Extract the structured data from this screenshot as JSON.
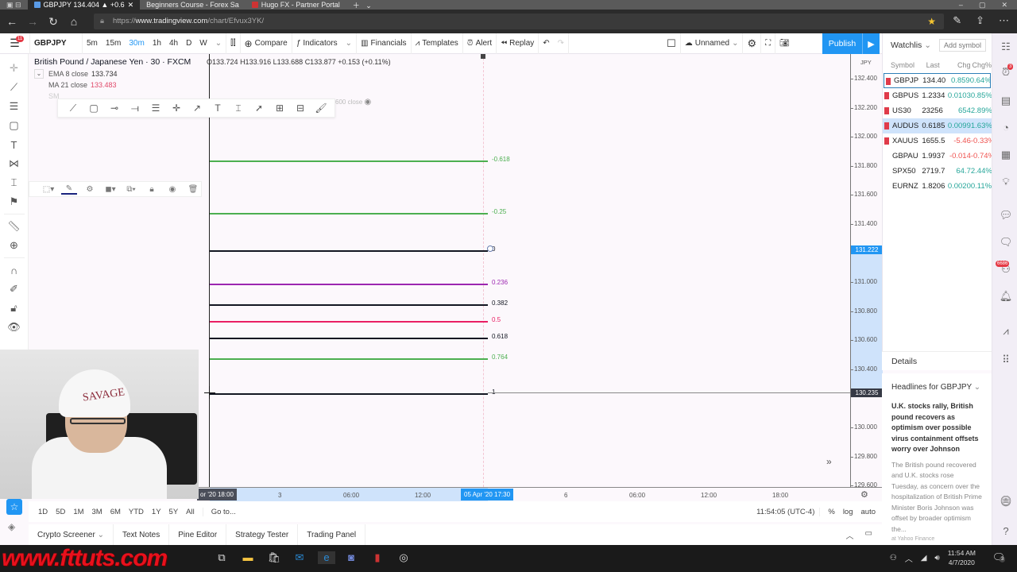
{
  "browser": {
    "tabs": [
      {
        "label": "GBPJPY 134.404 ▲ +0.6",
        "active": true
      },
      {
        "label": "Beginners Course - Forex Sa",
        "active": false
      },
      {
        "label": "Hugo FX - Partner Portal",
        "active": false
      }
    ],
    "url_prefix": "https://",
    "url_domain": "www.tradingview.com",
    "url_path": "/chart/Efvux3YK/"
  },
  "toolbar": {
    "menu_badge": "11",
    "symbol": "GBPJPY",
    "intervals": [
      "5m",
      "15m",
      "30m",
      "1h",
      "4h",
      "D",
      "W"
    ],
    "active_interval": "30m",
    "compare": "Compare",
    "indicators": "Indicators",
    "financials": "Financials",
    "templates": "Templates",
    "alert": "Alert",
    "replay": "Replay",
    "layout_name": "Unnamed",
    "publish": "Publish"
  },
  "legend": {
    "title": "British Pound / Japanese Yen · 30 · FXCM",
    "open": "O133.724",
    "high": "H133.916",
    "low": "L133.688",
    "close": "C133.877",
    "change": "+0.153 (+0.11%)",
    "indicators": [
      {
        "name": "EMA 8 close",
        "value": "133.734"
      },
      {
        "name": "MA 21 close",
        "value": "133.483"
      }
    ],
    "hidden_indicator": "600 close",
    "sma_prefix": "SM"
  },
  "fib_levels": [
    {
      "label": "-0.618",
      "color": "#4caf50",
      "price": 131.838
    },
    {
      "label": "-0.25",
      "color": "#4caf50",
      "price": 131.474
    },
    {
      "label": "0",
      "color": "#131722",
      "price": 131.222
    },
    {
      "label": "0.236",
      "color": "#9c27b0",
      "price": 130.992
    },
    {
      "label": "0.382",
      "color": "#131722",
      "price": 130.85
    },
    {
      "label": "0.5",
      "color": "#e91e63",
      "price": 130.734
    },
    {
      "label": "0.618",
      "color": "#131722",
      "price": 130.62
    },
    {
      "label": "0.764",
      "color": "#4caf50",
      "price": 130.475
    },
    {
      "label": "1",
      "color": "#131722",
      "price": 130.235
    }
  ],
  "price_axis": {
    "currency": "JPY",
    "ticks": [
      "132.400",
      "132.200",
      "132.000",
      "131.800",
      "131.600",
      "131.400",
      "131.000",
      "130.800",
      "130.600",
      "130.400",
      "130.000",
      "129.800",
      "129.600"
    ],
    "label_top": "131.222",
    "label_bottom": "130.235"
  },
  "time_axis": {
    "ticks": [
      "3",
      "06:00",
      "12:00",
      "6",
      "06:00",
      "12:00",
      "18:00"
    ],
    "label_left": "or '20   18:00",
    "label_right": "05 Apr '20   17:30"
  },
  "range_bar": {
    "ranges": [
      "1D",
      "5D",
      "1M",
      "3M",
      "6M",
      "YTD",
      "1Y",
      "5Y",
      "All"
    ],
    "goto": "Go to...",
    "time": "11:54:05 (UTC-4)",
    "percent": "%",
    "log": "log",
    "auto": "auto"
  },
  "bottom_tabs": [
    "Crypto Screener",
    "Text Notes",
    "Pine Editor",
    "Strategy Tester",
    "Trading Panel"
  ],
  "watchlist": {
    "title": "Watchlis",
    "add_symbol": "Add symbol",
    "columns": [
      "Symbol",
      "Last",
      "Chg",
      "Chg%"
    ],
    "rows": [
      {
        "symbol": "GBPJP",
        "last": "134.40",
        "chg": "0.859",
        "chgp": "0.64%",
        "dir": "pos",
        "flag": true,
        "state": "selected"
      },
      {
        "symbol": "GBPUS",
        "last": "1.2334",
        "chg": "0.0103",
        "chgp": "0.85%",
        "dir": "pos",
        "flag": true,
        "state": ""
      },
      {
        "symbol": "US30",
        "last": "23256",
        "chg": "654",
        "chgp": "2.89%",
        "dir": "pos",
        "flag": true,
        "state": ""
      },
      {
        "symbol": "AUDUS",
        "last": "0.6185",
        "chg": "0.0099",
        "chgp": "1.63%",
        "dir": "pos",
        "flag": true,
        "state": "highlighted"
      },
      {
        "symbol": "XAUUS",
        "last": "1655.5",
        "chg": "-5.46",
        "chgp": "-0.33%",
        "dir": "neg",
        "flag": true,
        "state": ""
      },
      {
        "symbol": "GBPAU",
        "last": "1.9937",
        "chg": "-0.014",
        "chgp": "-0.74%",
        "dir": "neg",
        "flag": false,
        "state": ""
      },
      {
        "symbol": "SPX50",
        "last": "2719.7",
        "chg": "64.7",
        "chgp": "2.44%",
        "dir": "pos",
        "flag": false,
        "state": ""
      },
      {
        "symbol": "EURNZ",
        "last": "1.8206",
        "chg": "0.0020",
        "chgp": "0.11%",
        "dir": "pos",
        "flag": false,
        "state": ""
      }
    ]
  },
  "details": {
    "title": "Details",
    "headlines_title": "Headlines for GBPJPY",
    "headline": "U.K. stocks rally, British pound recovers as optimism over possible virus containment offsets worry over Johnson",
    "body": "The British pound recovered and U.K. stocks rose Tuesday, as concern over the hospitalization of British Prime Minister Boris Johnson was offset by broader optimism the...",
    "source": "at Yahoo Finance"
  },
  "right_bar": {
    "alerts_badge": "3",
    "chat_badge": "6686"
  },
  "webcam": {
    "hat_text": "SAVAGE"
  },
  "taskbar": {
    "watermark": "www.fttuts.com",
    "time": "11:54 AM",
    "date": "4/7/2020",
    "notif_count": "3"
  }
}
